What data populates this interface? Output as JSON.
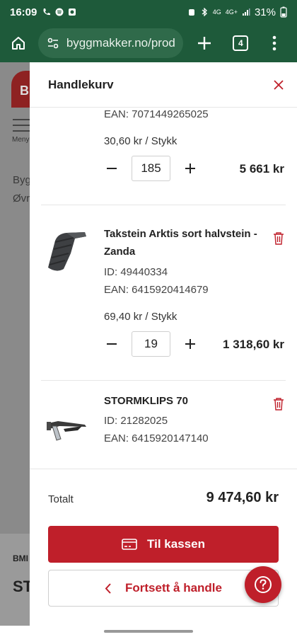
{
  "status_bar": {
    "time": "16:09",
    "battery": "31%",
    "network_labels": [
      "4G",
      "4G+"
    ]
  },
  "browser": {
    "url": "byggmakker.no/prod",
    "tab_count": "4"
  },
  "background_page": {
    "logo_letter": "B",
    "menu_label": "Meny",
    "line1": "Byg",
    "line2": "Øvr",
    "brand": "BMI",
    "heading": "ST"
  },
  "cart": {
    "title": "Handlekurv",
    "items": [
      {
        "ean": "EAN: 7071449265025",
        "unit_price": "30,60 kr / Stykk",
        "quantity": "185",
        "line_total": "5 661 kr"
      },
      {
        "name": "Takstein Arktis sort halvstein - Zanda",
        "id": "ID: 49440334",
        "ean": "EAN: 6415920414679",
        "unit_price": "69,40 kr / Stykk",
        "quantity": "19",
        "line_total": "1 318,60 kr"
      },
      {
        "name": "STORMKLIPS 70",
        "id": "ID: 21282025",
        "ean": "EAN: 6415920147140"
      }
    ],
    "total_label": "Totalt",
    "total_value": "9 474,60 kr",
    "checkout_label": "Til kassen",
    "continue_label": "Fortsett å handle"
  },
  "colors": {
    "brand_red": "#bf1f2a",
    "browser_green": "#1e5a3a"
  },
  "icons": [
    "home-icon",
    "site-settings-icon",
    "new-tab-icon",
    "tabs-icon",
    "overflow-menu-icon",
    "close-icon",
    "trash-icon",
    "card-icon",
    "chevron-left-icon",
    "help-icon"
  ]
}
